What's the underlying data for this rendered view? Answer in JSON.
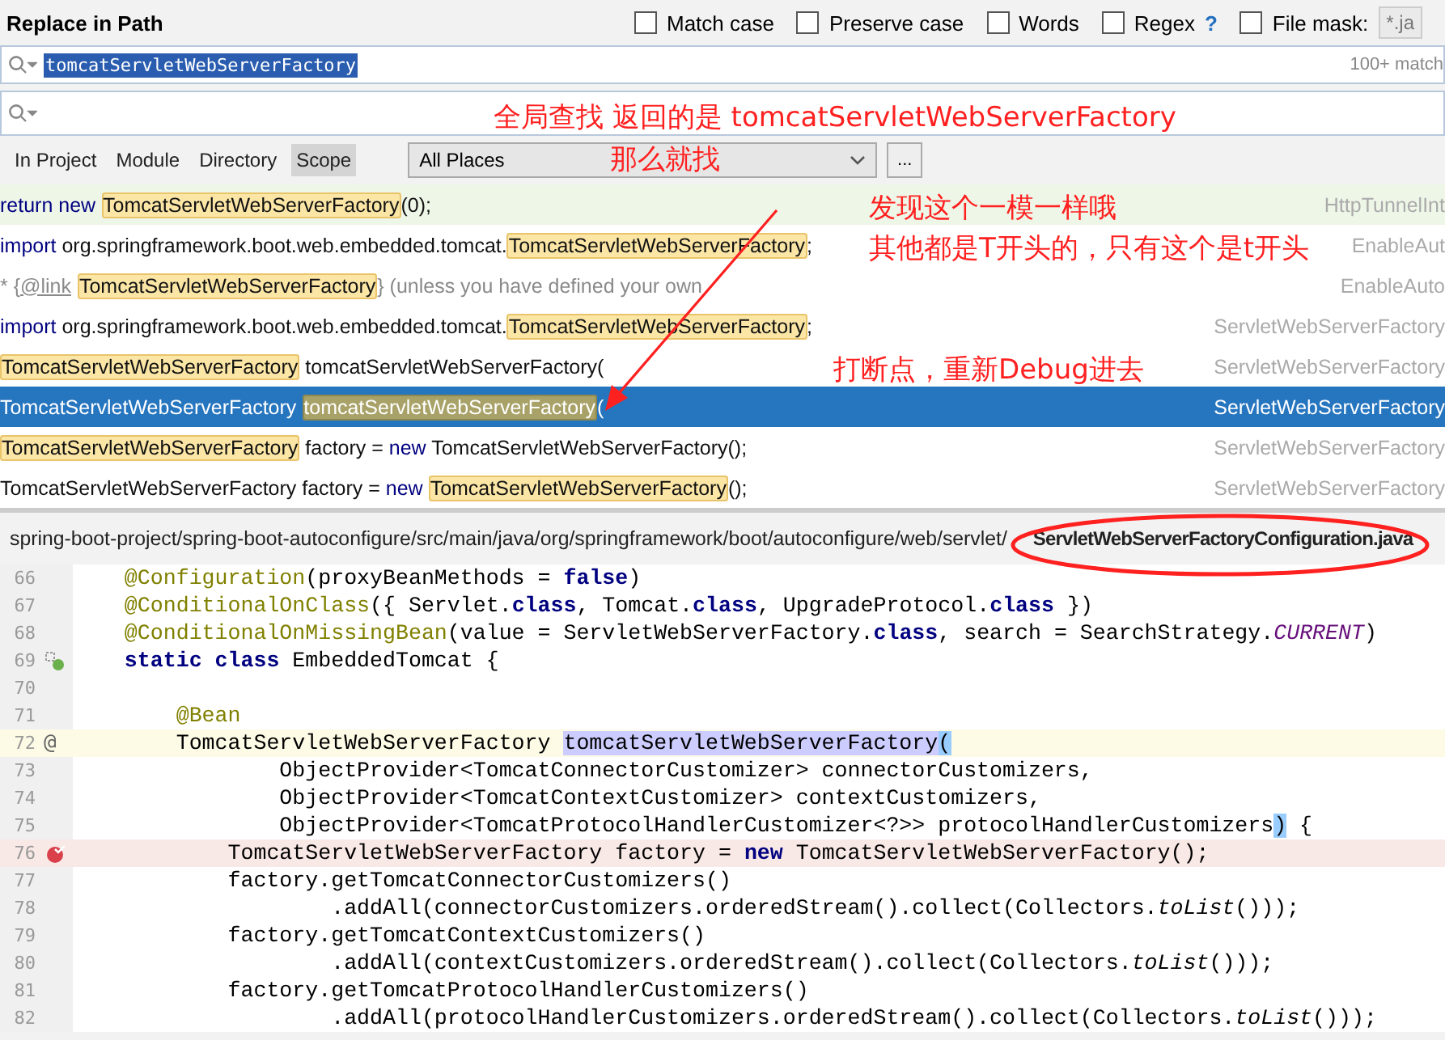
{
  "dialog": {
    "title": "Replace in Path"
  },
  "options": [
    {
      "label": "Match case",
      "checked": false
    },
    {
      "label": "Preserve case",
      "checked": false
    },
    {
      "label": "Words",
      "checked": false
    },
    {
      "label": "Regex",
      "checked": false,
      "help": "?"
    },
    {
      "label": "File mask:",
      "checked": false,
      "field": "*.ja"
    }
  ],
  "search": {
    "value": "tomcatServletWebServerFactory",
    "count": "100+ match"
  },
  "scopes": [
    {
      "label": "In Project",
      "selected": false
    },
    {
      "label": "Module",
      "selected": false
    },
    {
      "label": "Directory",
      "selected": false
    },
    {
      "label": "Scope",
      "selected": true
    }
  ],
  "scope_select": {
    "value": "All Places",
    "more": "..."
  },
  "results": [
    {
      "selected": false,
      "current": true,
      "file": "HttpTunnelInt",
      "segments": [
        {
          "kind": "keyword",
          "text": "return new "
        },
        {
          "kind": "match",
          "text": "TomcatServletWebServerFactory"
        },
        {
          "kind": "plain",
          "text": "(0);"
        }
      ]
    },
    {
      "selected": false,
      "current": false,
      "file": "EnableAut",
      "segments": [
        {
          "kind": "keyword",
          "text": "import"
        },
        {
          "kind": "plain",
          "text": " org.springframework.boot.web.embedded.tomcat."
        },
        {
          "kind": "match",
          "text": "TomcatServletWebServerFactory"
        },
        {
          "kind": "plain",
          "text": ";"
        }
      ]
    },
    {
      "selected": false,
      "current": false,
      "file": "EnableAuto",
      "segments": [
        {
          "kind": "comment",
          "text": "* {"
        },
        {
          "kind": "doctag",
          "text": "@link"
        },
        {
          "kind": "match",
          "text": "TomcatServletWebServerFactory"
        },
        {
          "kind": "comment",
          "text": "} (unless you have defined your own"
        }
      ]
    },
    {
      "selected": false,
      "current": false,
      "file": "ServletWebServerFactory",
      "segments": [
        {
          "kind": "keyword",
          "text": "import"
        },
        {
          "kind": "plain",
          "text": " org.springframework.boot.web.embedded.tomcat."
        },
        {
          "kind": "match",
          "text": "TomcatServletWebServerFactory"
        },
        {
          "kind": "plain",
          "text": ";"
        }
      ]
    },
    {
      "selected": false,
      "current": false,
      "file": "ServletWebServerFactory",
      "segments": [
        {
          "kind": "match",
          "text": "TomcatServletWebServerFactory"
        },
        {
          "kind": "plain",
          "text": " tomcatServletWebServerFactory("
        }
      ]
    },
    {
      "selected": true,
      "current": false,
      "file": "ServletWebServerFactory",
      "segments": [
        {
          "kind": "plain",
          "text": "TomcatServletWebServerFactory "
        },
        {
          "kind": "match",
          "text": "tomcatServletWebServerFactory"
        },
        {
          "kind": "plain",
          "text": "("
        }
      ]
    },
    {
      "selected": false,
      "current": false,
      "file": "ServletWebServerFactory",
      "segments": [
        {
          "kind": "match",
          "text": "TomcatServletWebServerFactory"
        },
        {
          "kind": "plain",
          "text": " factory = "
        },
        {
          "kind": "keyword",
          "text": "new"
        },
        {
          "kind": "plain",
          "text": " TomcatServletWebServerFactory();"
        }
      ]
    },
    {
      "selected": false,
      "current": false,
      "file": "ServletWebServerFactory",
      "segments": [
        {
          "kind": "plain",
          "text": "TomcatServletWebServerFactory factory = "
        },
        {
          "kind": "keyword",
          "text": "new "
        },
        {
          "kind": "match",
          "text": "TomcatServletWebServerFactory"
        },
        {
          "kind": "plain",
          "text": "();"
        }
      ]
    }
  ],
  "path_bar": {
    "path": "spring-boot-project/spring-boot-autoconfigure/src/main/java/org/springframework/boot/autoconfigure/web/servlet/",
    "file": "ServletWebServerFactoryConfiguration.java"
  },
  "code": [
    {
      "number": "66",
      "current": false,
      "breakpoint": false,
      "bean": false,
      "tokens": [
        {
          "kind": "annotation",
          "text": "    @Configuration"
        },
        {
          "kind": "plain",
          "text": "(proxyBeanMethods = "
        },
        {
          "kind": "keyword",
          "text": "false"
        },
        {
          "kind": "plain",
          "text": ")"
        }
      ]
    },
    {
      "number": "67",
      "current": false,
      "breakpoint": false,
      "bean": false,
      "tokens": [
        {
          "kind": "annotation",
          "text": "    @ConditionalOnClass"
        },
        {
          "kind": "plain",
          "text": "({ Servlet."
        },
        {
          "kind": "keyword",
          "text": "class"
        },
        {
          "kind": "plain",
          "text": ", Tomcat."
        },
        {
          "kind": "keyword",
          "text": "class"
        },
        {
          "kind": "plain",
          "text": ", UpgradeProtocol."
        },
        {
          "kind": "keyword",
          "text": "class"
        },
        {
          "kind": "plain",
          "text": " })"
        }
      ]
    },
    {
      "number": "68",
      "current": false,
      "breakpoint": false,
      "bean": false,
      "tokens": [
        {
          "kind": "annotation",
          "text": "    @ConditionalOnMissingBean"
        },
        {
          "kind": "plain",
          "text": "(value = ServletWebServerFactory."
        },
        {
          "kind": "keyword",
          "text": "class"
        },
        {
          "kind": "plain",
          "text": ", search = SearchStrategy."
        },
        {
          "kind": "constant",
          "text": "CURRENT"
        },
        {
          "kind": "plain",
          "text": ")"
        }
      ]
    },
    {
      "number": "69",
      "current": false,
      "breakpoint": false,
      "bean": true,
      "tokens": [
        {
          "kind": "keyword",
          "text": "    static class"
        },
        {
          "kind": "plain",
          "text": " EmbeddedTomcat {"
        }
      ]
    },
    {
      "number": "70",
      "current": false,
      "breakpoint": false,
      "bean": false
    },
    {
      "number": "71",
      "current": false,
      "breakpoint": false,
      "bean": false,
      "tokens": [
        {
          "kind": "annotation",
          "text": "        @Bean"
        }
      ]
    },
    {
      "number": "72",
      "current": true,
      "breakpoint": false,
      "bean": false,
      "mark": "@",
      "tokens": [
        {
          "kind": "plain",
          "text": "        TomcatServletWebServerFactory "
        },
        {
          "kind": "selection",
          "text": "tomcatServletWebServerFactory"
        },
        {
          "kind": "brace",
          "text": "("
        }
      ]
    },
    {
      "number": "73",
      "current": false,
      "breakpoint": false,
      "bean": false,
      "tokens": [
        {
          "kind": "plain",
          "text": "                ObjectProvider<TomcatConnectorCustomizer> connectorCustomizers,"
        }
      ]
    },
    {
      "number": "74",
      "current": false,
      "breakpoint": false,
      "bean": false,
      "tokens": [
        {
          "kind": "plain",
          "text": "                ObjectProvider<TomcatContextCustomizer> contextCustomizers,"
        }
      ]
    },
    {
      "number": "75",
      "current": false,
      "breakpoint": false,
      "bean": false,
      "tokens": [
        {
          "kind": "plain",
          "text": "                ObjectProvider<TomcatProtocolHandlerCustomizer<?>> protocolHandlerCustomizers"
        },
        {
          "kind": "brace",
          "text": ")"
        },
        {
          "kind": "plain",
          "text": " {"
        }
      ]
    },
    {
      "number": "76",
      "current": false,
      "breakpoint": true,
      "bean": false,
      "tokens": [
        {
          "kind": "plain",
          "text": "            TomcatServletWebServerFactory factory = "
        },
        {
          "kind": "keyword",
          "text": "new"
        },
        {
          "kind": "plain",
          "text": " TomcatServletWebServerFactory();"
        }
      ]
    },
    {
      "number": "77",
      "current": false,
      "breakpoint": false,
      "bean": false,
      "tokens": [
        {
          "kind": "plain",
          "text": "            factory.getTomcatConnectorCustomizers()"
        }
      ]
    },
    {
      "number": "78",
      "current": false,
      "breakpoint": false,
      "bean": false,
      "tokens": [
        {
          "kind": "plain",
          "text": "                    .addAll(connectorCustomizers.orderedStream().collect(Collectors."
        },
        {
          "kind": "static",
          "text": "toList"
        },
        {
          "kind": "plain",
          "text": "()));"
        }
      ]
    },
    {
      "number": "79",
      "current": false,
      "breakpoint": false,
      "bean": false,
      "tokens": [
        {
          "kind": "plain",
          "text": "            factory.getTomcatContextCustomizers()"
        }
      ]
    },
    {
      "number": "80",
      "current": false,
      "breakpoint": false,
      "bean": false,
      "tokens": [
        {
          "kind": "plain",
          "text": "                    .addAll(contextCustomizers.orderedStream().collect(Collectors."
        },
        {
          "kind": "static",
          "text": "toList"
        },
        {
          "kind": "plain",
          "text": "()));"
        }
      ]
    },
    {
      "number": "81",
      "current": false,
      "breakpoint": false,
      "bean": false,
      "tokens": [
        {
          "kind": "plain",
          "text": "            factory.getTomcatProtocolHandlerCustomizers()"
        }
      ]
    },
    {
      "number": "82",
      "current": false,
      "breakpoint": false,
      "bean": false,
      "tokens": [
        {
          "kind": "plain",
          "text": "                    .addAll(protocolHandlerCustomizers.orderedStream().collect(Collectors."
        },
        {
          "kind": "static",
          "text": "toList"
        },
        {
          "kind": "plain",
          "text": "()));"
        }
      ]
    }
  ],
  "annotations": [
    "全局查找   返回的是  tomcatServletWebServerFactory",
    "那么就找",
    "发现这个一模一样哦",
    "其他都是T开头的，只有这个是t开头",
    "打断点，重新Debug进去"
  ]
}
